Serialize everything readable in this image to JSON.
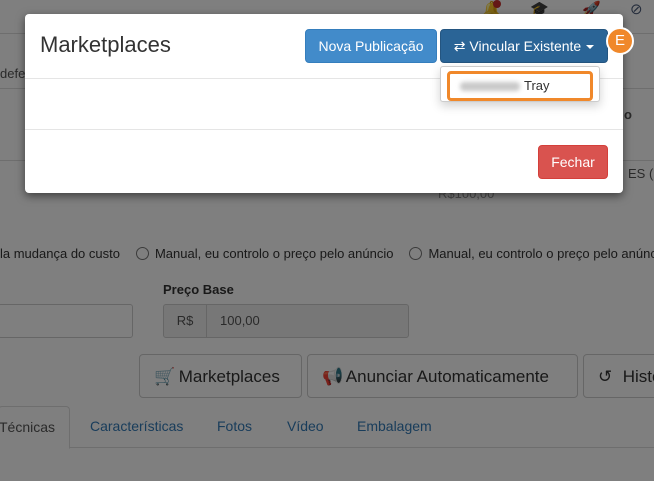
{
  "background": {
    "radio_options": [
      "la mudança do custo",
      "Manual, eu controlo o preço pelo anúncio",
      "Manual, eu controlo o preço pelo anúncio"
    ],
    "partial_texts": {
      "left_field": "defe",
      "right_header": "o",
      "right_text": "ES (",
      "price_hint": "R$100,00"
    },
    "price_field": {
      "label": "Preço Base",
      "prefix": "R$",
      "value": "100,00"
    },
    "action_buttons": [
      {
        "label": "Marketplaces",
        "icon": "cart-icon"
      },
      {
        "label": "Anunciar Automaticamente",
        "icon": "megaphone-icon"
      },
      {
        "label": "Histo",
        "icon": "history-icon"
      }
    ],
    "tabs": [
      {
        "label": "Técnicas",
        "active": true
      },
      {
        "label": "Características",
        "active": false
      },
      {
        "label": "Fotos",
        "active": false
      },
      {
        "label": "Vídeo",
        "active": false
      },
      {
        "label": "Embalagem",
        "active": false
      }
    ]
  },
  "modal": {
    "title": "Marketplaces",
    "new_publication_label": "Nova Publicação",
    "link_existing_label": "Vincular Existente",
    "link_icon": "exchange-icon",
    "close_label": "Fechar",
    "dropdown_items": [
      {
        "label": "Tray",
        "redacted_prefix": true
      }
    ]
  },
  "step_badge": "E",
  "colors": {
    "primary": "#428bca",
    "primary_dark": "#2a6496",
    "danger": "#d9534f",
    "highlight": "#f0882a",
    "link": "#337ab7"
  }
}
